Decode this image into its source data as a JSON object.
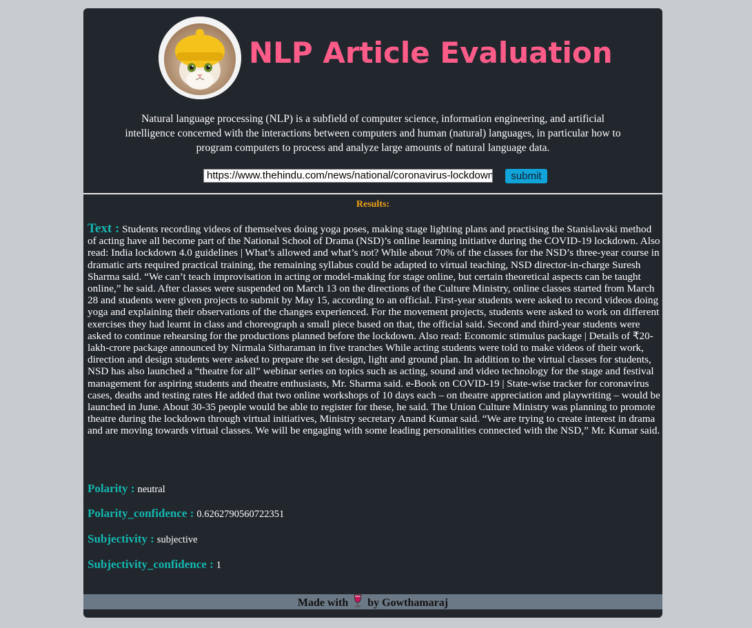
{
  "header": {
    "title": "NLP Article Evaluation",
    "logo_icon": "cat-avatar-icon"
  },
  "intro": {
    "line1": "Natural language processing (NLP) is a subfield of computer science, information engineering, and artificial",
    "line2": "intelligence concerned with the interactions between computers and human (natural) languages, in particular how to",
    "line3": "program computers to process and analyze large amounts of natural language data."
  },
  "form": {
    "url_value": "https://www.thehindu.com/news/national/coronavirus-lockdown",
    "submit_label": "submit"
  },
  "results": {
    "heading": "Results:",
    "text_label": "Text :",
    "text_value": "Students recording videos of themselves doing yoga poses, making stage lighting plans and practising the Stanislavski method of acting have all become part of the National School of Drama (NSD)’s online learning initiative during the COVID-19 lockdown. Also read: India lockdown 4.0 guidelines | What’s allowed and what’s not? While about 70% of the classes for the NSD’s three-year course in dramatic arts required practical training, the remaining syllabus could be adapted to virtual teaching, NSD director-in-charge Suresh Sharma said. “We can’t teach improvisation in acting or model-making for stage online, but certain theoretical aspects can be taught online,” he said. After classes were suspended on March 13 on the directions of the Culture Ministry, online classes started from March 28 and students were given projects to submit by May 15, according to an official. First-year students were asked to record videos doing yoga and explaining their observations of the changes experienced. For the movement projects, students were asked to work on different exercises they had learnt in class and choreograph a small piece based on that, the official said. Second and third-year students were asked to continue rehearsing for the productions planned before the lockdown. Also read: Economic stimulus package | Details of ₹20-lakh-crore package announced by Nirmala Sitharaman in five tranches While acting students were told to make videos of their work, direction and design students were asked to prepare the set design, light and ground plan. In addition to the virtual classes for students, NSD has also launched a “theatre for all” webinar series on topics such as acting, sound and video technology for the stage and festival management for aspiring students and theatre enthusiasts, Mr. Sharma said. e-Book on COVID-19 | State-wise tracker for coronavirus cases, deaths and testing rates He added that two online workshops of 10 days each – on theatre appreciation and playwriting – would be launched in June. About 30-35 people would be able to register for these, he said. The Union Culture Ministry was planning to promote theatre during the lockdown through virtual initiatives, Ministry secretary Anand Kumar said. “We are trying to create interest in drama and are moving towards virtual classes. We will be engaging with some leading personalities connected with the NSD,” Mr. Kumar said.",
    "polarity_label": "Polarity :",
    "polarity_value": "neutral",
    "polarity_conf_label": "Polarity_confidence :",
    "polarity_conf_value": "0.6262790560722351",
    "subjectivity_label": "Subjectivity :",
    "subjectivity_value": "subjective",
    "subjectivity_conf_label": "Subjectivity_confidence :",
    "subjectivity_conf_value": "1"
  },
  "footer": {
    "made_with": "Made with",
    "by": "by Gowthamaraj",
    "icon": "wine-glass-icon"
  },
  "colors": {
    "background": "#c8ccd0",
    "card": "#22262d",
    "title": "#ff5c8a",
    "label": "#14b8b0",
    "results_heading": "#f0a31a",
    "submit": "#10a4d9",
    "footer": "#6b7885"
  }
}
